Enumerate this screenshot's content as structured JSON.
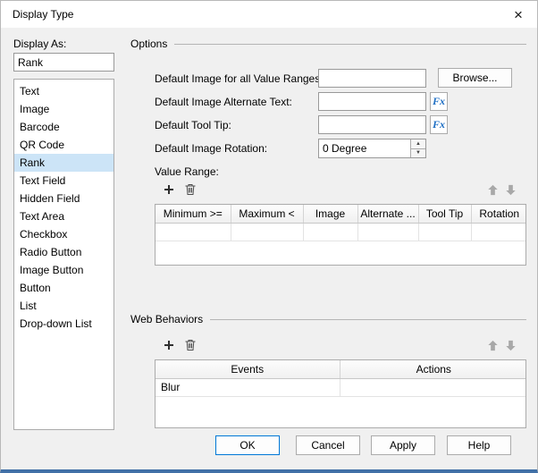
{
  "window": {
    "title": "Display Type",
    "close_glyph": "×"
  },
  "display_as": {
    "label": "Display As:",
    "value": "Rank"
  },
  "type_list": {
    "items": [
      "Text",
      "Image",
      "Barcode",
      "QR Code",
      "Rank",
      "Text Field",
      "Hidden Field",
      "Text Area",
      "Checkbox",
      "Radio Button",
      "Image Button",
      "Button",
      "List",
      "Drop-down List"
    ],
    "selected": "Rank"
  },
  "options": {
    "title": "Options",
    "default_image_label": "Default Image for all Value Ranges:",
    "default_image_value": "",
    "browse_label": "Browse...",
    "alt_text_label": "Default Image Alternate Text:",
    "alt_text_value": "",
    "tooltip_label": "Default Tool Tip:",
    "tooltip_value": "",
    "fx_label": "Fx",
    "rotation_label": "Default Image Rotation:",
    "rotation_value": "0 Degree",
    "value_range_label": "Value Range:",
    "value_range_columns": [
      "Minimum >=",
      "Maximum <",
      "Image",
      "Alternate ...",
      "Tool Tip",
      "Rotation"
    ],
    "value_range_rows": [
      [
        "",
        "",
        "",
        "",
        "",
        ""
      ]
    ]
  },
  "web_behaviors": {
    "title": "Web Behaviors",
    "columns": [
      "Events",
      "Actions"
    ],
    "rows": [
      {
        "event": "Blur",
        "action": ""
      }
    ]
  },
  "icons": {
    "spin_up": "▲",
    "spin_down": "▼"
  },
  "footer": {
    "ok": "OK",
    "cancel": "Cancel",
    "apply": "Apply",
    "help": "Help"
  },
  "colors": {
    "accent": "#0078d7",
    "selection": "#cce4f7",
    "window_border": "#4170a7",
    "fx_blue": "#1f6fc4"
  }
}
